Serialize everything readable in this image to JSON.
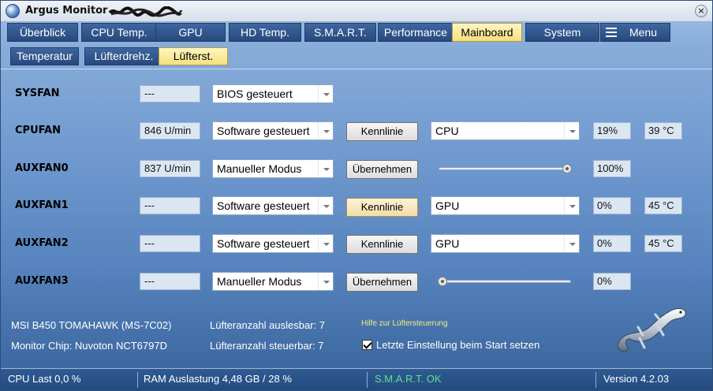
{
  "app": {
    "title": "Argus Monitor -"
  },
  "tabs": [
    {
      "label": "Überblick",
      "active": false
    },
    {
      "label": "CPU Temp.",
      "active": false
    },
    {
      "label": "GPU",
      "active": false
    },
    {
      "label": "HD Temp.",
      "active": false
    },
    {
      "label": "S.M.A.R.T.",
      "active": false
    },
    {
      "label": "Performance",
      "active": false
    },
    {
      "label": "Mainboard",
      "active": true
    },
    {
      "label": "System",
      "active": false
    },
    {
      "label": "Menu",
      "active": false
    }
  ],
  "subtabs": [
    {
      "label": "Temperatur",
      "active": false
    },
    {
      "label": "Lüfterdrehz.",
      "active": false
    },
    {
      "label": "Lüfterst.",
      "active": true
    }
  ],
  "fans": [
    {
      "name": "SYSFAN",
      "rpm": "---",
      "mode": "BIOS gesteuert"
    },
    {
      "name": "CPUFAN",
      "rpm": "846 U/min",
      "mode": "Software gesteuert",
      "button": "Kennlinie",
      "source": "CPU",
      "percent": "19%",
      "temp": "39 °C"
    },
    {
      "name": "AUXFAN0",
      "rpm": "837 U/min",
      "mode": "Manueller Modus",
      "button": "Übernehmen",
      "percent": "100%",
      "slider_value": 1.0
    },
    {
      "name": "AUXFAN1",
      "rpm": "---",
      "mode": "Software gesteuert",
      "button": "Kennlinie",
      "source": "GPU",
      "percent": "0%",
      "temp": "45 °C"
    },
    {
      "name": "AUXFAN2",
      "rpm": "---",
      "mode": "Software gesteuert",
      "button": "Kennlinie",
      "source": "GPU",
      "percent": "0%",
      "temp": "45 °C"
    },
    {
      "name": "AUXFAN3",
      "rpm": "---",
      "mode": "Manueller Modus",
      "button": "Übernehmen",
      "percent": "0%",
      "slider_value": 0.0
    }
  ],
  "info": {
    "board": "MSI B450 TOMAHAWK (MS-7C02)",
    "chip": "Monitor Chip: Nuvoton NCT6797D",
    "readable": "Lüfteranzahl auslesbar: 7",
    "controllable": "Lüfteranzahl steuerbar: 7",
    "help": "Hilfe zur Lüftersteuerung",
    "checkbox_label": "Letzte Einstellung beim Start setzen",
    "checkbox_checked": true
  },
  "status": {
    "cpu": "CPU Last 0,0 %",
    "ram": "RAM Auslastung 4,48 GB / 28 %",
    "smart": "S.M.A.R.T. OK",
    "version": "Version 4.2.03"
  },
  "colors": {
    "active_tab": "#f6df7f",
    "tab": "#27497d",
    "smart_ok": "#5fe08a",
    "help_link": "#f1ec7a"
  }
}
